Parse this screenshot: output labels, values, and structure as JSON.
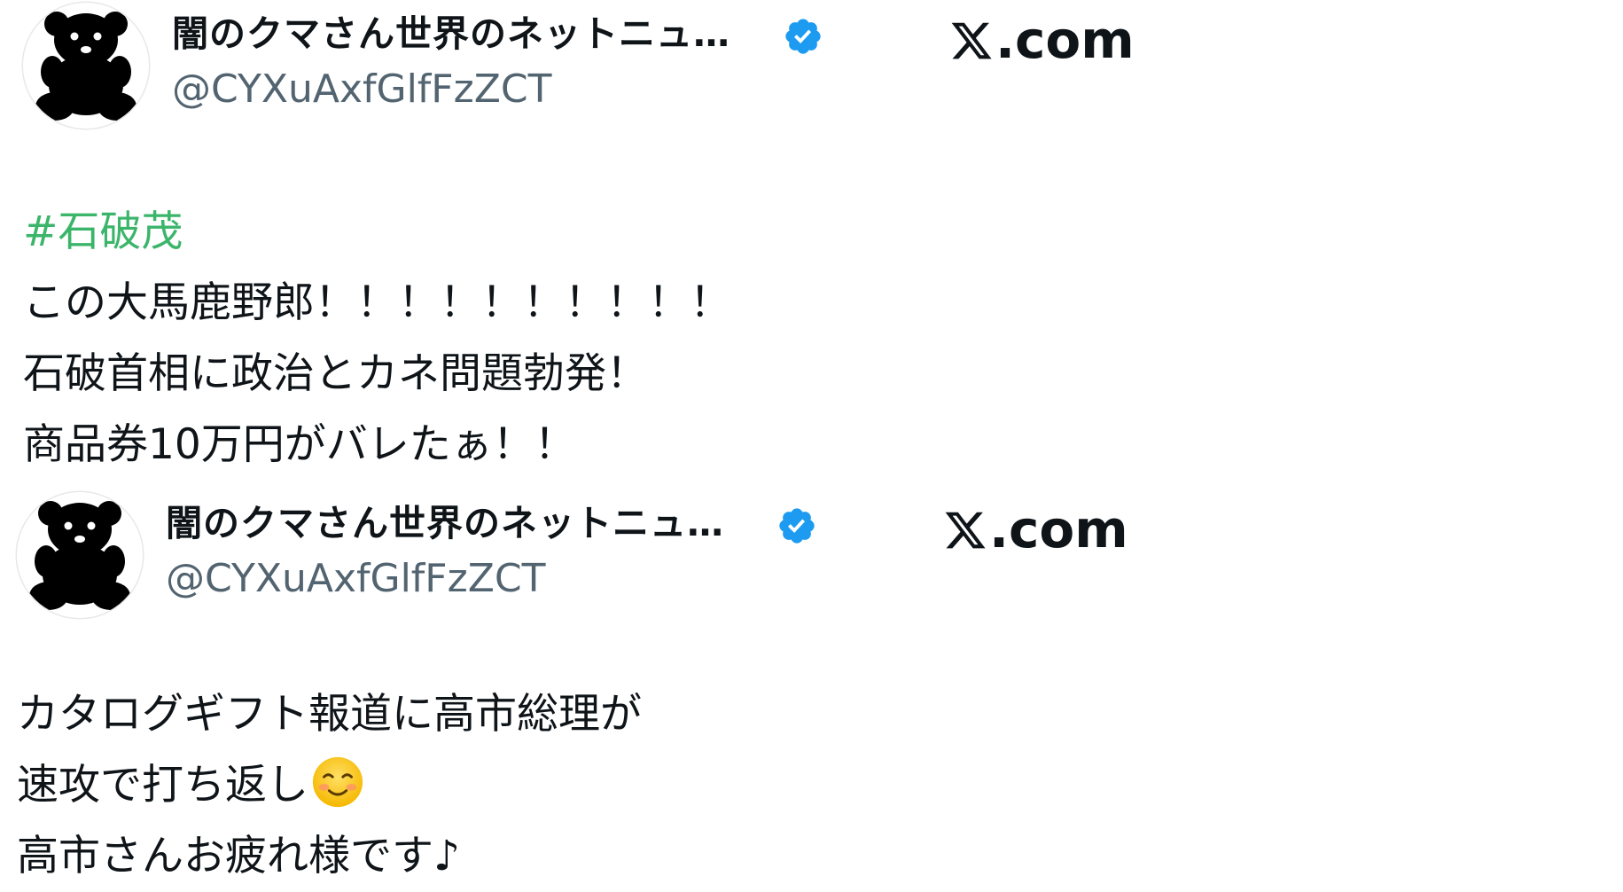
{
  "posts": [
    {
      "author": {
        "display_name": "闇のクマさん世界のネットニュ…",
        "handle": "@CYXuAxfGlfFzZCT",
        "verified": true,
        "avatar_icon": "black-bear-icon"
      },
      "brand": {
        "icon": "x-logo-icon",
        "text": ".com"
      },
      "lines": [
        {
          "text": "#石破茂",
          "kind": "hashtag"
        },
        {
          "text": "この大馬鹿野郎！！！！！！！！！！"
        },
        {
          "text": "石破首相に政治とカネ問題勃発！"
        },
        {
          "text": "商品券10万円がバレたぁ！！"
        }
      ]
    },
    {
      "author": {
        "display_name": "闇のクマさん世界のネットニュ…",
        "handle": "@CYXuAxfGlfFzZCT",
        "verified": true,
        "avatar_icon": "black-bear-icon"
      },
      "brand": {
        "icon": "x-logo-icon",
        "text": ".com"
      },
      "lines": [
        {
          "text": "カタログギフト報道に高市総理が"
        },
        {
          "text": "速攻で打ち返し",
          "emoji": "smiling-face-icon"
        },
        {
          "text": "高市さんお疲れ様です♪"
        }
      ]
    }
  ],
  "colors": {
    "hashtag": "#3bb56a",
    "verified": "#1d9bf0",
    "handle": "#536471",
    "text": "#0f1419"
  }
}
